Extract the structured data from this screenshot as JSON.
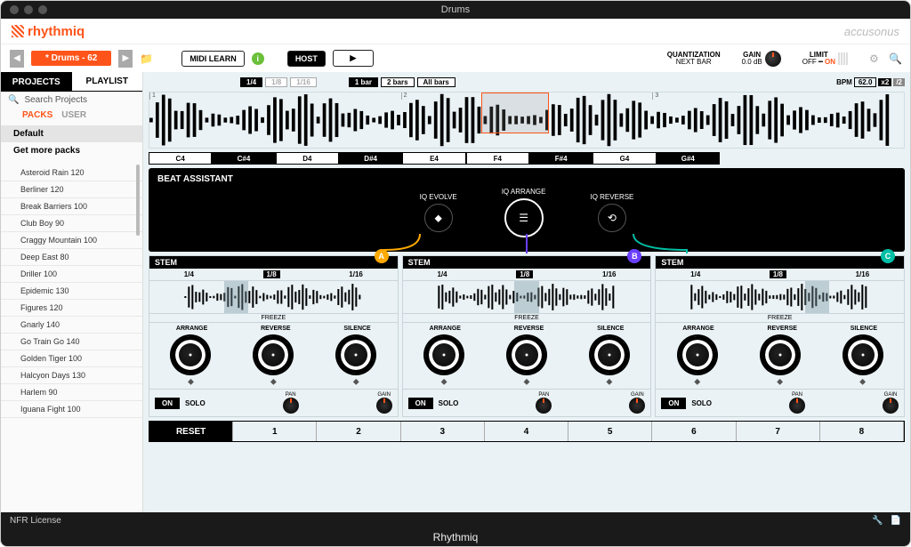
{
  "window": {
    "title": "Drums",
    "app_name": "Rhythmiq"
  },
  "brand": {
    "name": "rhythmiq",
    "company": "accusonus"
  },
  "toolbar": {
    "project_chip": "* Drums - 62",
    "midi_learn": "MIDI LEARN",
    "host": "HOST",
    "quantization_label": "QUANTIZATION",
    "quantization_value": "NEXT BAR",
    "gain_label": "GAIN",
    "gain_value": "0.0 dB",
    "limit_label": "LIMIT",
    "limit_off": "OFF",
    "limit_on": "ON"
  },
  "sidebar": {
    "tabs": {
      "projects": "PROJECTS",
      "playlist": "PLAYLIST"
    },
    "search_placeholder": "Search Projects",
    "packs_label": "PACKS",
    "user_label": "USER",
    "default_pack": "Default",
    "get_more": "Get more packs",
    "items": [
      "Asteroid Rain 120",
      "Berliner 120",
      "Break Barriers 100",
      "Club Boy 90",
      "Craggy Mountain 100",
      "Deep East 80",
      "Driller 100",
      "Epidemic 130",
      "Figures 120",
      "Gnarly 140",
      "Go Train Go 140",
      "Golden Tiger 100",
      "Halcyon Days 130",
      "Harlem 90",
      "Iguana Fight 100"
    ]
  },
  "waveform": {
    "grid": [
      "1/4",
      "1/8",
      "1/16"
    ],
    "bars": [
      "1 bar",
      "2 bars",
      "All bars"
    ],
    "bpm_label": "BPM",
    "bpm_value": "62.0",
    "keys": [
      "C4",
      "C#4",
      "D4",
      "D#4",
      "E4",
      "F4",
      "F#4",
      "G4",
      "G#4"
    ],
    "markers": [
      "1",
      "2",
      "3"
    ]
  },
  "beat_assistant": {
    "title": "BEAT ASSISTANT",
    "evolve": "IQ EVOLVE",
    "arrange": "IQ ARRANGE",
    "reverse": "IQ REVERSE"
  },
  "stem": {
    "label": "STEM",
    "grid": [
      "1/4",
      "1/8",
      "1/16"
    ],
    "freeze": "FREEZE",
    "arrange": "ARRANGE",
    "reverse": "REVERSE",
    "silence": "SILENCE",
    "on": "ON",
    "solo": "SOLO",
    "pan": "PAN",
    "gain": "GAIN",
    "badges": [
      "A",
      "B",
      "C"
    ]
  },
  "scenes": {
    "reset": "RESET",
    "nums": [
      "1",
      "2",
      "3",
      "4",
      "5",
      "6",
      "7",
      "8"
    ]
  },
  "footer": {
    "license": "NFR License"
  }
}
